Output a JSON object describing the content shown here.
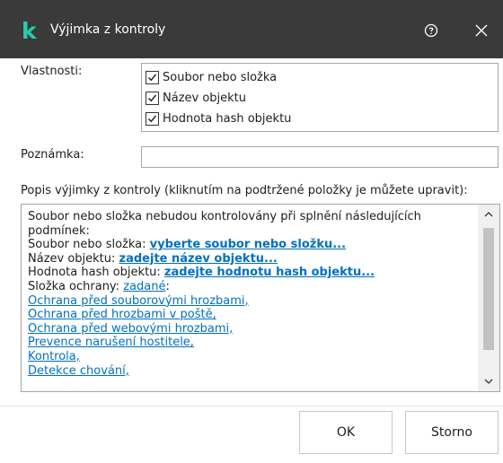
{
  "window": {
    "logo_letter": "k",
    "title": "Výjimka z kontroly",
    "help_icon": "help-circle-icon",
    "close_icon": "close-icon"
  },
  "colors": {
    "titlebar_bg": "#3a3a3a",
    "logo": "#29ccb1",
    "link": "#0070c0"
  },
  "properties": {
    "label": "Vlastnosti:",
    "items": [
      {
        "label": "Soubor nebo složka",
        "checked": true
      },
      {
        "label": "Název objektu",
        "checked": true
      },
      {
        "label": "Hodnota hash objektu",
        "checked": true
      }
    ]
  },
  "note": {
    "label": "Poznámka:",
    "value": ""
  },
  "description": {
    "label": "Popis výjimky z kontroly (kliknutím na podtržené položky je můžete upravit):",
    "intro": "Soubor nebo složka nebudou kontrolovány při splnění následujících podmínek:",
    "file_label": "Soubor nebo složka: ",
    "file_link": "vyberte soubor nebo složku...",
    "name_label": "Název objektu: ",
    "name_link": "zadejte název objektu...",
    "hash_label": "Hodnota hash objektu: ",
    "hash_link": "zadejte hodnotu hash objektu...",
    "component_label": "Složka ochrany: ",
    "component_link": "zadané",
    "component_suffix": ":",
    "components": [
      "Ochrana před souborovými hrozbami,",
      "Ochrana před hrozbami v poště,",
      "Ochrana před webovými hrozbami,",
      "Prevence narušení hostitele,",
      "Kontrola,",
      "Detekce chování,"
    ]
  },
  "buttons": {
    "ok": "OK",
    "cancel": "Storno"
  }
}
